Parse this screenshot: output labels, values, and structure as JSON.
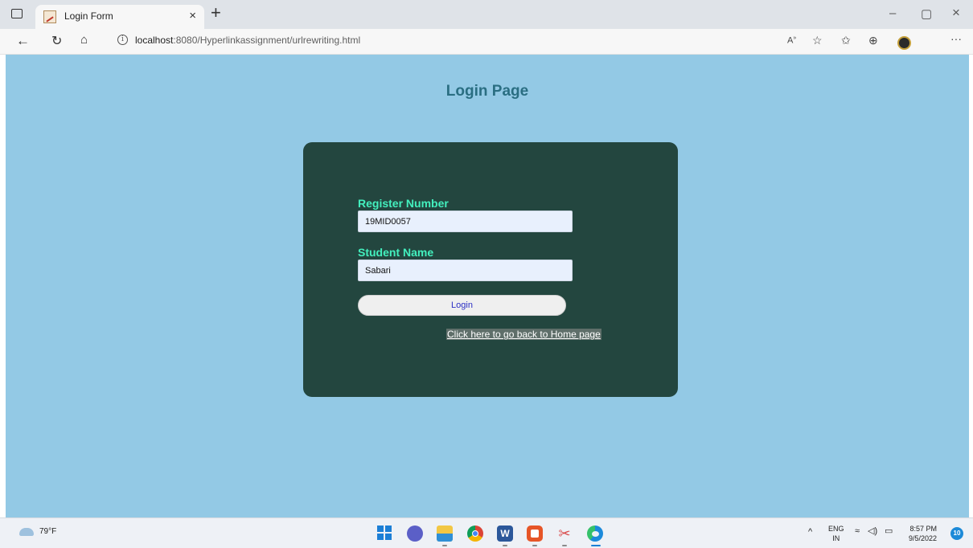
{
  "browser": {
    "tab_title": "Login Form",
    "tab_close": "×",
    "new_tab": "+",
    "url_host": "localhost",
    "url_path": ":8080/Hyperlinkassignment/urlrewriting.html",
    "window_controls": {
      "minimize": "–",
      "maximize": "▢",
      "close": "×"
    },
    "nav_icons": [
      "back-arrow-icon",
      "refresh-icon",
      "home-icon",
      "info-icon"
    ],
    "toolbar_icons": [
      "read-aloud-icon",
      "add-favorite-icon",
      "favorites-icon",
      "collections-icon",
      "profile-icon",
      "more-icon"
    ]
  },
  "page": {
    "background_color": "#93c9e5",
    "title": "Login Page",
    "form": {
      "register_label": "Register Number",
      "register_value": "19MID0057",
      "name_label": "Student Name",
      "name_value": "Sabari",
      "login_button": "Login",
      "home_link": "Click here to go back to Home page"
    }
  },
  "taskbar": {
    "weather_temp": "79°F",
    "apps": [
      "start-icon",
      "chat-icon",
      "file-explorer-icon",
      "chrome-icon",
      "word-icon",
      "office-icon",
      "snipping-tool-icon",
      "edge-icon"
    ],
    "language_top": "ENG",
    "language_bottom": "IN",
    "time": "8:57 PM",
    "date": "9/5/2022",
    "notification_count": "10"
  }
}
